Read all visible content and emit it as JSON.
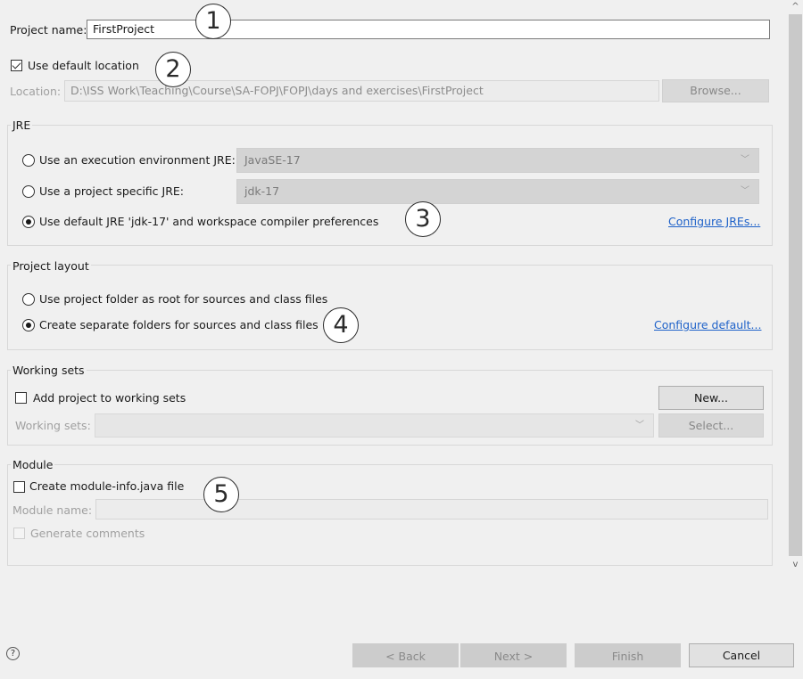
{
  "project": {
    "name_label": "Project name:",
    "name_value": "FirstProject"
  },
  "location": {
    "use_default_label": "Use default location",
    "use_default_checked": true,
    "label": "Location:",
    "value": "D:\\ISS Work\\Teaching\\Course\\SA-FOPJ\\FOPJ\\days and exercises\\FirstProject",
    "browse_label": "Browse..."
  },
  "jre": {
    "title": "JRE",
    "option_exec_env": "Use an execution environment JRE:",
    "exec_env_value": "JavaSE-17",
    "option_project_specific": "Use a project specific JRE:",
    "project_specific_value": "jdk-17",
    "option_default": "Use default JRE 'jdk-17' and workspace compiler preferences",
    "configure_link": "Configure JREs..."
  },
  "layout": {
    "title": "Project layout",
    "option_root": "Use project folder as root for sources and class files",
    "option_separate": "Create separate folders for sources and class files",
    "configure_link": "Configure default..."
  },
  "working_sets": {
    "title": "Working sets",
    "add_label": "Add project to working sets",
    "new_label": "New...",
    "sets_label": "Working sets:",
    "select_label": "Select..."
  },
  "module": {
    "title": "Module",
    "create_label": "Create module-info.java file",
    "name_label": "Module name:",
    "generate_label": "Generate comments"
  },
  "footer": {
    "help_glyph": "?",
    "back_label": "< Back",
    "next_label": "Next >",
    "finish_label": "Finish",
    "cancel_label": "Cancel"
  },
  "callouts": [
    "1",
    "2",
    "3",
    "4",
    "5"
  ],
  "icons": {
    "chevron": "﹀",
    "scroll_up": "^",
    "scroll_down": "v"
  },
  "colors": {
    "link": "#1f62c9",
    "background": "#f0f0f0",
    "disabled_button": "#cccccc"
  }
}
